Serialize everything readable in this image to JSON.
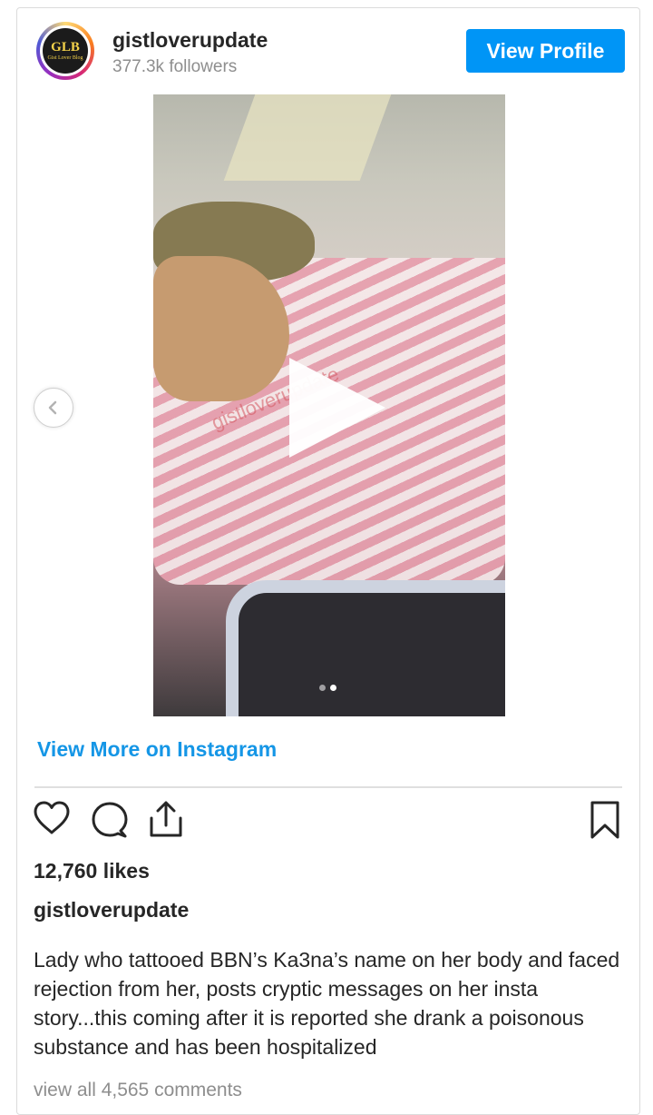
{
  "profile": {
    "username": "gistloverupdate",
    "followers": "377.3k followers",
    "view_profile_label": "View Profile",
    "logo_text": "GLB",
    "logo_subtext": "Gist Lover Blog"
  },
  "media": {
    "watermark": "gistloverupdate",
    "icon": "play-icon",
    "carousel_count": 2,
    "carousel_active_index": 2
  },
  "links": {
    "view_more": "View More on Instagram"
  },
  "actions": {
    "icons": [
      "heart-icon",
      "comment-icon",
      "share-icon",
      "bookmark-icon"
    ]
  },
  "post": {
    "likes": "12,760 likes",
    "caption_username": "gistloverupdate",
    "caption": "Lady who tattooed BBN’s Ka3na’s name on her body and faced rejection from her, posts cryptic messages on her insta story...this coming after it is reported she drank a poisonous substance and has been hospitalized",
    "comments_link": "view all 4,565 comments"
  },
  "colors": {
    "accent": "#0095f6",
    "link": "#1596e6",
    "text": "#262626",
    "muted": "#8e8e8e"
  }
}
